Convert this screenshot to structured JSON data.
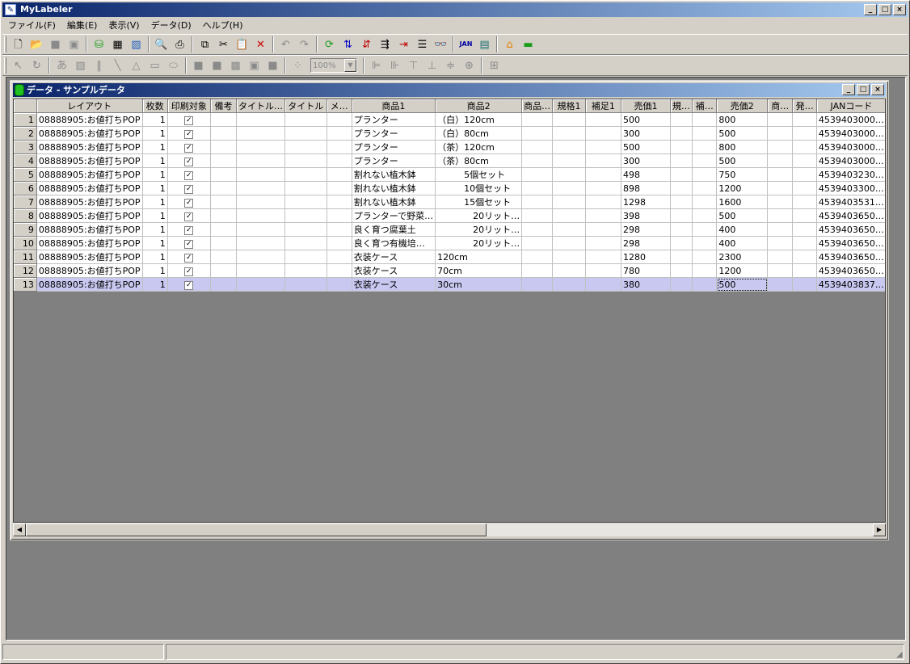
{
  "window": {
    "title": "MyLabeler"
  },
  "menu": [
    "ファイル(F)",
    "編集(E)",
    "表示(V)",
    "データ(D)",
    "ヘルプ(H)"
  ],
  "toolbar2": {
    "zoom": "100%"
  },
  "child": {
    "title": "データ - サンプルデータ"
  },
  "grid": {
    "columns": [
      "レイアウト",
      "枚数",
      "印刷対象",
      "備考",
      "タイトル…",
      "タイトル",
      "メ…",
      "商品1",
      "商品2",
      "商品…",
      "規格1",
      "補足1",
      "売価1",
      "規…",
      "補…",
      "売価2",
      "商…",
      "発…",
      "JANコード"
    ],
    "rows": [
      {
        "n": "1",
        "layout": "08888905:お値打ちPOP",
        "qty": "1",
        "p1": "プランター",
        "p2": "（白）120cm",
        "s1": "500",
        "s2": "800",
        "jan": "4539403000…"
      },
      {
        "n": "2",
        "layout": "08888905:お値打ちPOP",
        "qty": "1",
        "p1": "プランター",
        "p2": "（白）80cm",
        "s1": "300",
        "s2": "500",
        "jan": "4539403000…"
      },
      {
        "n": "3",
        "layout": "08888905:お値打ちPOP",
        "qty": "1",
        "p1": "プランター",
        "p2": "（茶）120cm",
        "s1": "500",
        "s2": "800",
        "jan": "4539403000…"
      },
      {
        "n": "4",
        "layout": "08888905:お値打ちPOP",
        "qty": "1",
        "p1": "プランター",
        "p2": "（茶）80cm",
        "s1": "300",
        "s2": "500",
        "jan": "4539403000…"
      },
      {
        "n": "5",
        "layout": "08888905:お値打ちPOP",
        "qty": "1",
        "p1": "割れない植木鉢",
        "p2": "　　　5個セット",
        "s1": "498",
        "s2": "750",
        "jan": "4539403230…"
      },
      {
        "n": "6",
        "layout": "08888905:お値打ちPOP",
        "qty": "1",
        "p1": "割れない植木鉢",
        "p2": "　　　10個セット",
        "s1": "898",
        "s2": "1200",
        "jan": "4539403300…"
      },
      {
        "n": "7",
        "layout": "08888905:お値打ちPOP",
        "qty": "1",
        "p1": "割れない植木鉢",
        "p2": "　　　15個セット",
        "s1": "1298",
        "s2": "1600",
        "jan": "4539403531…"
      },
      {
        "n": "8",
        "layout": "08888905:お値打ちPOP",
        "qty": "1",
        "p1": "プランターで野菜…",
        "p2": "　　　　20リット…",
        "s1": "398",
        "s2": "500",
        "jan": "4539403650…"
      },
      {
        "n": "9",
        "layout": "08888905:お値打ちPOP",
        "qty": "1",
        "p1": "良く育つ腐葉土",
        "p2": "　　　　20リット…",
        "s1": "298",
        "s2": "400",
        "jan": "4539403650…"
      },
      {
        "n": "10",
        "layout": "08888905:お値打ちPOP",
        "qty": "1",
        "p1": "良く育つ有機培…",
        "p2": "　　　　20リット…",
        "s1": "298",
        "s2": "400",
        "jan": "4539403650…"
      },
      {
        "n": "11",
        "layout": "08888905:お値打ちPOP",
        "qty": "1",
        "p1": "衣装ケース",
        "p2": "120cm",
        "s1": "1280",
        "s2": "2300",
        "jan": "4539403650…"
      },
      {
        "n": "12",
        "layout": "08888905:お値打ちPOP",
        "qty": "1",
        "p1": "衣装ケース",
        "p2": "70cm",
        "s1": "780",
        "s2": "1200",
        "jan": "4539403650…"
      },
      {
        "n": "13",
        "layout": "08888905:お値打ちPOP",
        "qty": "1",
        "p1": "衣装ケース",
        "p2": "30cm",
        "s1": "380",
        "s2": "500",
        "jan": "4539403837…"
      }
    ]
  }
}
